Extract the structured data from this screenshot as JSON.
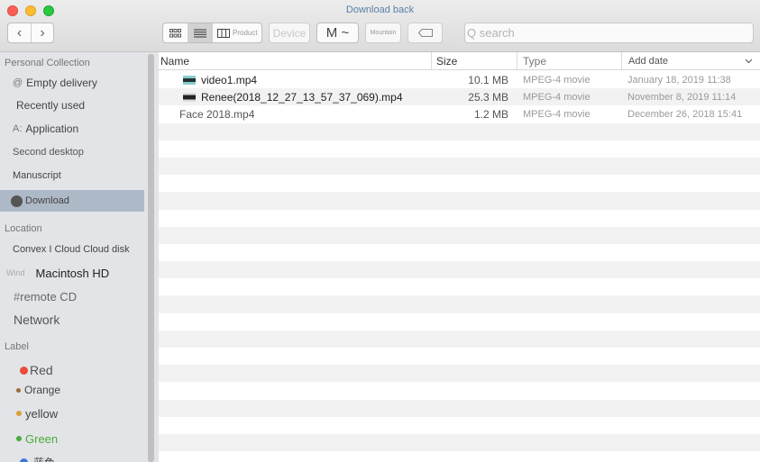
{
  "window": {
    "title": "Download back"
  },
  "toolbar": {
    "back_icon": "‹",
    "forward_icon": "›",
    "column_view_label": "Product",
    "device_label": "Device",
    "m_label": "M ~",
    "mountain_label": "Mountain",
    "search_placeholder": "Q search"
  },
  "sidebar": {
    "personal_header": "Personal Collection",
    "personal_items": [
      {
        "lead": "@",
        "label": "Empty delivery"
      },
      {
        "lead": "",
        "label": "Recently used"
      },
      {
        "lead": "A:",
        "label": "Application"
      },
      {
        "lead": "",
        "label": "Second desktop"
      },
      {
        "lead": "",
        "label": "Manuscript"
      },
      {
        "lead": "",
        "label": "Download"
      }
    ],
    "location_header": "Location",
    "location_items": [
      {
        "lead": "",
        "label": "Convex I Cloud Cloud disk"
      },
      {
        "lead": "Wind",
        "label": "Macintosh HD"
      },
      {
        "lead": "#",
        "label": "remote CD"
      },
      {
        "lead": "",
        "label": "Network"
      }
    ],
    "label_header": "Label",
    "tags": [
      {
        "label": "Red",
        "color": "#e94b3c"
      },
      {
        "label": "Orange",
        "color": "#a06b3a"
      },
      {
        "label": "yellow",
        "color": "#d8a23a"
      },
      {
        "label": "Green",
        "color": "#4cab3d"
      },
      {
        "label": "蓝色",
        "color": "#3e7ad6"
      }
    ]
  },
  "columns": {
    "name": "Name",
    "size": "Size",
    "type": "Type",
    "date": "Add date"
  },
  "files": [
    {
      "name": "video1.mp4",
      "size": "10.1 MB",
      "type": "MPEG-4 movie",
      "date": "January 18, 2019 11:38"
    },
    {
      "name": "Renee(2018_12_27_13_57_37_069).mp4",
      "size": "25.3 MB",
      "type": "MPEG-4 movie",
      "date": "November 8, 2019 11:14"
    },
    {
      "name": "Face 2018.mp4",
      "size": "1.2 MB",
      "type": "MPEG-4 movie",
      "date": "December 26, 2018 15:41"
    }
  ]
}
